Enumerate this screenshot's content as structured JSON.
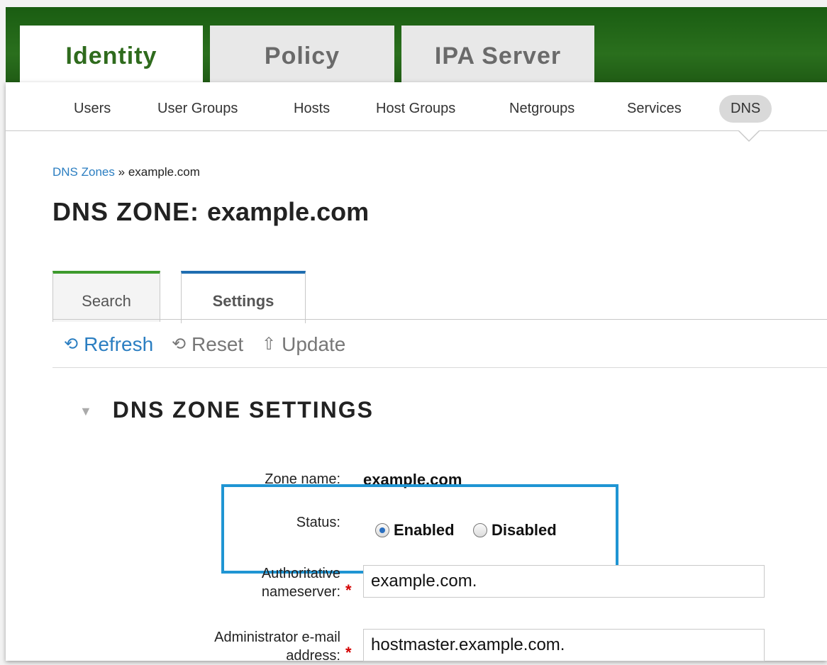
{
  "top_tabs": [
    {
      "label": "Identity",
      "active": true
    },
    {
      "label": "Policy",
      "active": false
    },
    {
      "label": "IPA Server",
      "active": false
    }
  ],
  "nav": [
    {
      "label": "Users"
    },
    {
      "label": "User Groups"
    },
    {
      "label": "Hosts"
    },
    {
      "label": "Host Groups"
    },
    {
      "label": "Netgroups"
    },
    {
      "label": "Services"
    },
    {
      "label": "DNS",
      "active": true
    }
  ],
  "breadcrumb": {
    "parent": "DNS Zones",
    "separator": "»",
    "current": "example.com"
  },
  "page_title": {
    "prefix": "DNS ZONE:",
    "object": "example.com"
  },
  "facet_tabs": [
    {
      "label": "Search"
    },
    {
      "label": "Settings",
      "active": true
    }
  ],
  "toolbar": {
    "refresh": "Refresh",
    "reset": "Reset",
    "update": "Update"
  },
  "section": {
    "title": "DNS ZONE SETTINGS"
  },
  "fields": {
    "zone_name": {
      "label": "Zone name:",
      "value": "example.com"
    },
    "status": {
      "label": "Status:",
      "options": [
        "Enabled",
        "Disabled"
      ],
      "selected": "Enabled"
    },
    "nameserver": {
      "label_line1": "Authoritative",
      "label_line2": "nameserver:",
      "value": "example.com."
    },
    "admin_email": {
      "label_line1": "Administrator e-mail",
      "label_line2": "address:",
      "value": "hostmaster.example.com."
    }
  },
  "colors": {
    "header_green": "#2a6f1d",
    "link_blue": "#2b7ec1",
    "highlight_blue": "#1f95d3",
    "required_red": "#d40000"
  }
}
